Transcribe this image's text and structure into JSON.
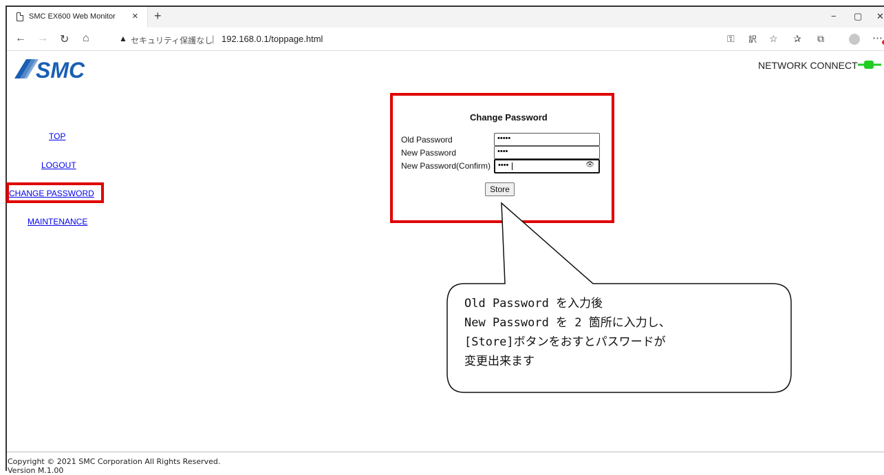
{
  "browser": {
    "tab_title": "SMC EX600 Web Monitor",
    "tab_close": "×",
    "new_tab": "+",
    "security_warning": "セキュリティ保護なし",
    "separator": "|",
    "url": "192.168.0.1/toppage.html",
    "window_controls": {
      "minimize": "−",
      "maximize": "▢",
      "close": "✕"
    }
  },
  "header": {
    "logo_text": "SMC",
    "network_status": "NETWORK CONNECT",
    "network_color": "#22cc22"
  },
  "sidebar": {
    "items": [
      {
        "label": "TOP"
      },
      {
        "label": "LOGOUT"
      },
      {
        "label": "CHANGE PASSWORD"
      },
      {
        "label": "MAINTENANCE"
      }
    ]
  },
  "form": {
    "title": "Change Password",
    "old_password_label": "Old Password",
    "old_password_value": "•••••",
    "new_password_label": "New Password",
    "new_password_value": "••••",
    "confirm_label": "New Password(Confirm)",
    "confirm_value": "••••",
    "store_label": "Store"
  },
  "callout": {
    "text": "Old Password を入力後\nNew Password を 2 箇所に入力し、\n[Store]ボタンをおすとパスワードが\n変更出来ます"
  },
  "footer": {
    "copyright": "Copyright © 2021 SMC Corporation All Rights Reserved.",
    "version": "Version M.1.00"
  },
  "colors": {
    "highlight": "#e00000",
    "link": "#0000ee",
    "logo": "#1a5fb4"
  }
}
